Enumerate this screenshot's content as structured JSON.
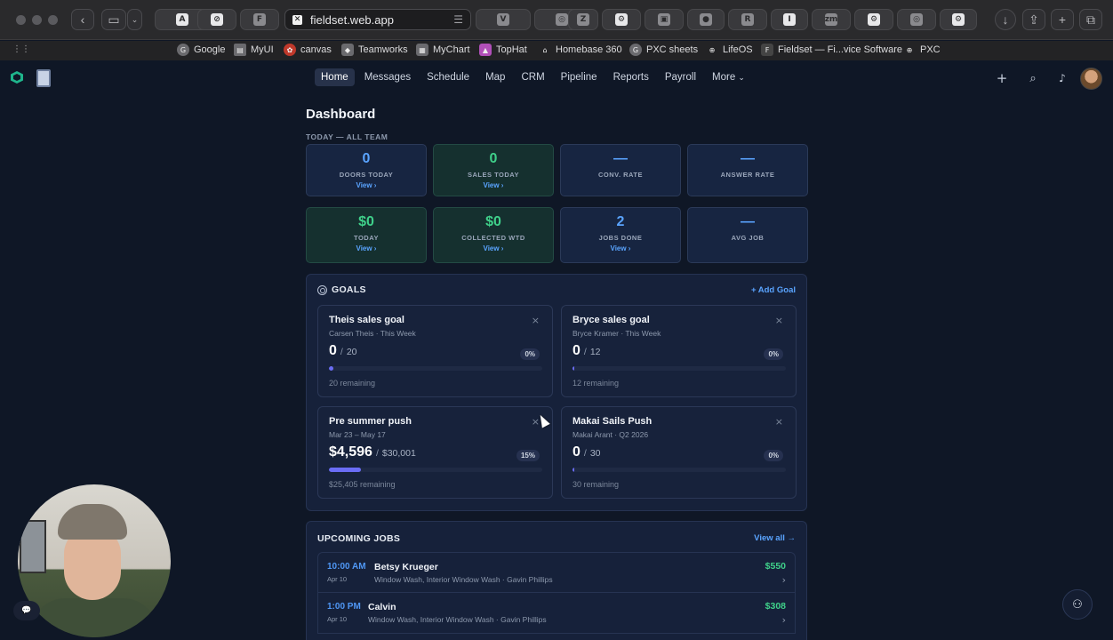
{
  "browser": {
    "url": "fieldset.web.app",
    "tabs": [
      {
        "icon": "app-store-icon"
      },
      {
        "icon": "compass-icon"
      },
      {
        "icon": "fieldset-tab-icon",
        "glyph": "F"
      },
      {
        "icon": "v-tab-icon",
        "glyph": "V"
      },
      {
        "icon": "chrome-icon"
      },
      {
        "icon": "z-tab-icon",
        "glyph": "Z"
      },
      {
        "icon": "settings-tab-icon"
      },
      {
        "icon": "image-tab-icon"
      },
      {
        "icon": "circle-tab-icon"
      },
      {
        "icon": "r-tab-icon",
        "glyph": "R"
      },
      {
        "icon": "i-tab-icon",
        "glyph": "I"
      },
      {
        "icon": "zm-tab-icon",
        "glyph": "zm"
      },
      {
        "icon": "gear-tab-icon"
      },
      {
        "icon": "chrome-icon-2"
      },
      {
        "icon": "gear-tab-icon-2"
      }
    ],
    "bookmarks": [
      "Google",
      "MyUI",
      "canvas",
      "Teamworks",
      "MyChart",
      "TopHat",
      "Homebase 360",
      "PXC sheets",
      "LifeOS",
      "Fieldset — Fi...vice Software",
      "PXC"
    ]
  },
  "nav": {
    "links": [
      "Home",
      "Messages",
      "Schedule",
      "Map",
      "CRM",
      "Pipeline",
      "Reports",
      "Payroll",
      "More"
    ],
    "active": "Home",
    "more_chevron": "⌄"
  },
  "dashboard": {
    "title": "Dashboard",
    "section_label": "TODAY — ALL TEAM",
    "stats_row1": [
      {
        "value": "0",
        "label": "DOORS TODAY",
        "link": "View ›",
        "tone": "blue"
      },
      {
        "value": "0",
        "label": "SALES TODAY",
        "link": "View ›",
        "tone": "green"
      },
      {
        "value": "—",
        "label": "CONV. RATE",
        "link": "",
        "tone": "blue"
      },
      {
        "value": "—",
        "label": "ANSWER RATE",
        "link": "",
        "tone": "blue"
      }
    ],
    "stats_row2": [
      {
        "value": "$0",
        "label": "TODAY",
        "link": "View ›",
        "tone": "green"
      },
      {
        "value": "$0",
        "label": "COLLECTED WTD",
        "link": "View ›",
        "tone": "green"
      },
      {
        "value": "2",
        "label": "JOBS DONE",
        "link": "View ›",
        "tone": "blue"
      },
      {
        "value": "—",
        "label": "AVG JOB",
        "link": "",
        "tone": "blue"
      }
    ]
  },
  "goals": {
    "heading": "GOALS",
    "add_label": "+ Add Goal",
    "items": [
      {
        "title": "Theis sales goal",
        "subtitle": "Carsen Theis · This Week",
        "current": "0",
        "target": "20",
        "percent_label": "0%",
        "progress": 0.02,
        "remaining": "20 remaining"
      },
      {
        "title": "Bryce sales goal",
        "subtitle": "Bryce Kramer · This Week",
        "current": "0",
        "target": "12",
        "percent_label": "0%",
        "progress": 0.01,
        "remaining": "12 remaining"
      },
      {
        "title": "Pre summer push",
        "subtitle": "Mar 23 – May 17",
        "current": "$4,596",
        "target": "$30,001",
        "percent_label": "15%",
        "progress": 0.15,
        "remaining": "$25,405 remaining"
      },
      {
        "title": "Makai Sails Push",
        "subtitle": "Makai Arant · Q2 2026",
        "current": "0",
        "target": "30",
        "percent_label": "0%",
        "progress": 0.01,
        "remaining": "30 remaining"
      }
    ],
    "close_glyph": "×",
    "separator": "/"
  },
  "jobs": {
    "heading": "UPCOMING JOBS",
    "view_all": "View all →",
    "items": [
      {
        "time": "10:00 AM",
        "date": "Apr 10",
        "name": "Betsy Krueger",
        "desc": "Window Wash, Interior Window Wash · Gavin Phillips",
        "amount": "$550"
      },
      {
        "time": "1:00 PM",
        "date": "Apr 10",
        "name": "Calvin",
        "desc": "Window Wash, Interior Window Wash · Gavin Phillips",
        "amount": "$308"
      }
    ],
    "chevron": "›"
  },
  "colors": {
    "accent_blue": "#5aa4ff",
    "accent_green": "#3fd08a",
    "progress_purple": "#6b6df5",
    "background": "#0f1726"
  }
}
